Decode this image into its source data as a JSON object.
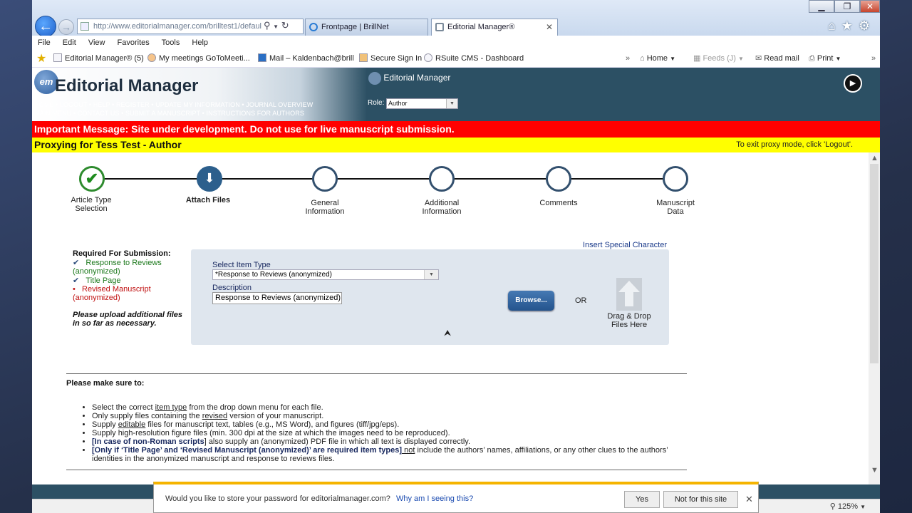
{
  "browser": {
    "address": "http://www.editorialmanager.com/brilltest1/defaul",
    "tabs": [
      {
        "label": "Frontpage | BrillNet"
      },
      {
        "label": "Editorial Manager®"
      }
    ],
    "menu": [
      "File",
      "Edit",
      "View",
      "Favorites",
      "Tools",
      "Help"
    ],
    "favorites": [
      "Editorial Manager® (5)",
      "My meetings GoToMeeti...",
      "Mail – Kaldenbach@brill",
      "Secure Sign In",
      "RSuite CMS - Dashboard"
    ],
    "command_bar": {
      "home": "Home",
      "feeds": "Feeds (J)",
      "read_mail": "Read mail",
      "print": "Print"
    },
    "zoom": "125%"
  },
  "em": {
    "logo_text": "Editorial Manager",
    "logo_badge": "em",
    "nav_row1": "HOME  •  LOGOUT  •  HELP  •  REGISTER  •  UPDATE MY INFORMATION  •  JOURNAL OVERVIEW",
    "nav_row2": "MAIN MENU  •  CONTACT US  •  SUBMIT A MANUSCRIPT  •  INSTRUCTIONS FOR AUTHORS",
    "small_logo": "Editorial Manager",
    "role_label": "Role:",
    "role_value": "Author"
  },
  "important_message": "Important Message: Site under development. Do not use for live manuscript submission.",
  "proxy": {
    "title": "Proxying for Tess Test - Author",
    "exit_hint": "To exit proxy mode, click 'Logout'."
  },
  "steps": [
    {
      "label_line1": "Article Type",
      "label_line2": "Selection",
      "state": "done"
    },
    {
      "label_line1": "Attach Files",
      "label_line2": "",
      "state": "current"
    },
    {
      "label_line1": "General",
      "label_line2": "Information",
      "state": "pending"
    },
    {
      "label_line1": "Additional",
      "label_line2": "Information",
      "state": "pending"
    },
    {
      "label_line1": "Comments",
      "label_line2": "",
      "state": "pending"
    },
    {
      "label_line1": "Manuscript",
      "label_line2": "Data",
      "state": "pending"
    }
  ],
  "insert_special": "Insert Special Character",
  "required": {
    "title": "Required For Submission:",
    "items": [
      {
        "label": "Response to Reviews (anonymized)",
        "status": "ok"
      },
      {
        "label": "Title Page",
        "status": "ok"
      },
      {
        "label": "Revised Manuscript (anonymized)",
        "status": "missing"
      }
    ],
    "note": "Please upload additional files in so far as necessary."
  },
  "upload": {
    "select_label": "Select Item Type",
    "select_value": "*Response to Reviews (anonymized)",
    "description_label": "Description",
    "description_value": "Response to Reviews (anonymized)",
    "browse_label": "Browse...",
    "or_label": "OR",
    "drop_label_line1": "Drag & Drop",
    "drop_label_line2": "Files Here"
  },
  "instructions": {
    "heading": "Please make sure to:",
    "items": [
      [
        "Select the correct ",
        "item type",
        " from the drop down menu for each file."
      ],
      [
        "Only supply files containing the ",
        "revised",
        " version of your manuscript."
      ],
      [
        "Supply ",
        "editable",
        " files for manuscript text, tables (e.g., MS Word), and figures (tiff/jpg/eps)."
      ],
      [
        "Supply high-resolution figure files (min. 300 dpi at the size at which the images need to be reproduced)."
      ],
      [
        "[In case of ",
        "non-Roman scripts",
        "] also supply an (anonymized) PDF file in which all text is displayed correctly."
      ],
      [
        "[Only if ‘Title Page’ and ‘Revised Manuscript (anonymized)’ are required item types]",
        " not",
        " include the authors’ names, affiliations, or any other clues to the authors’ identities in the anonymized manuscript and response to reviews files."
      ]
    ]
  },
  "password_prompt": {
    "message": "Would you like to store your password for editorialmanager.com?",
    "why": "Why am I seeing this?",
    "yes": "Yes",
    "never": "Not for this site"
  }
}
